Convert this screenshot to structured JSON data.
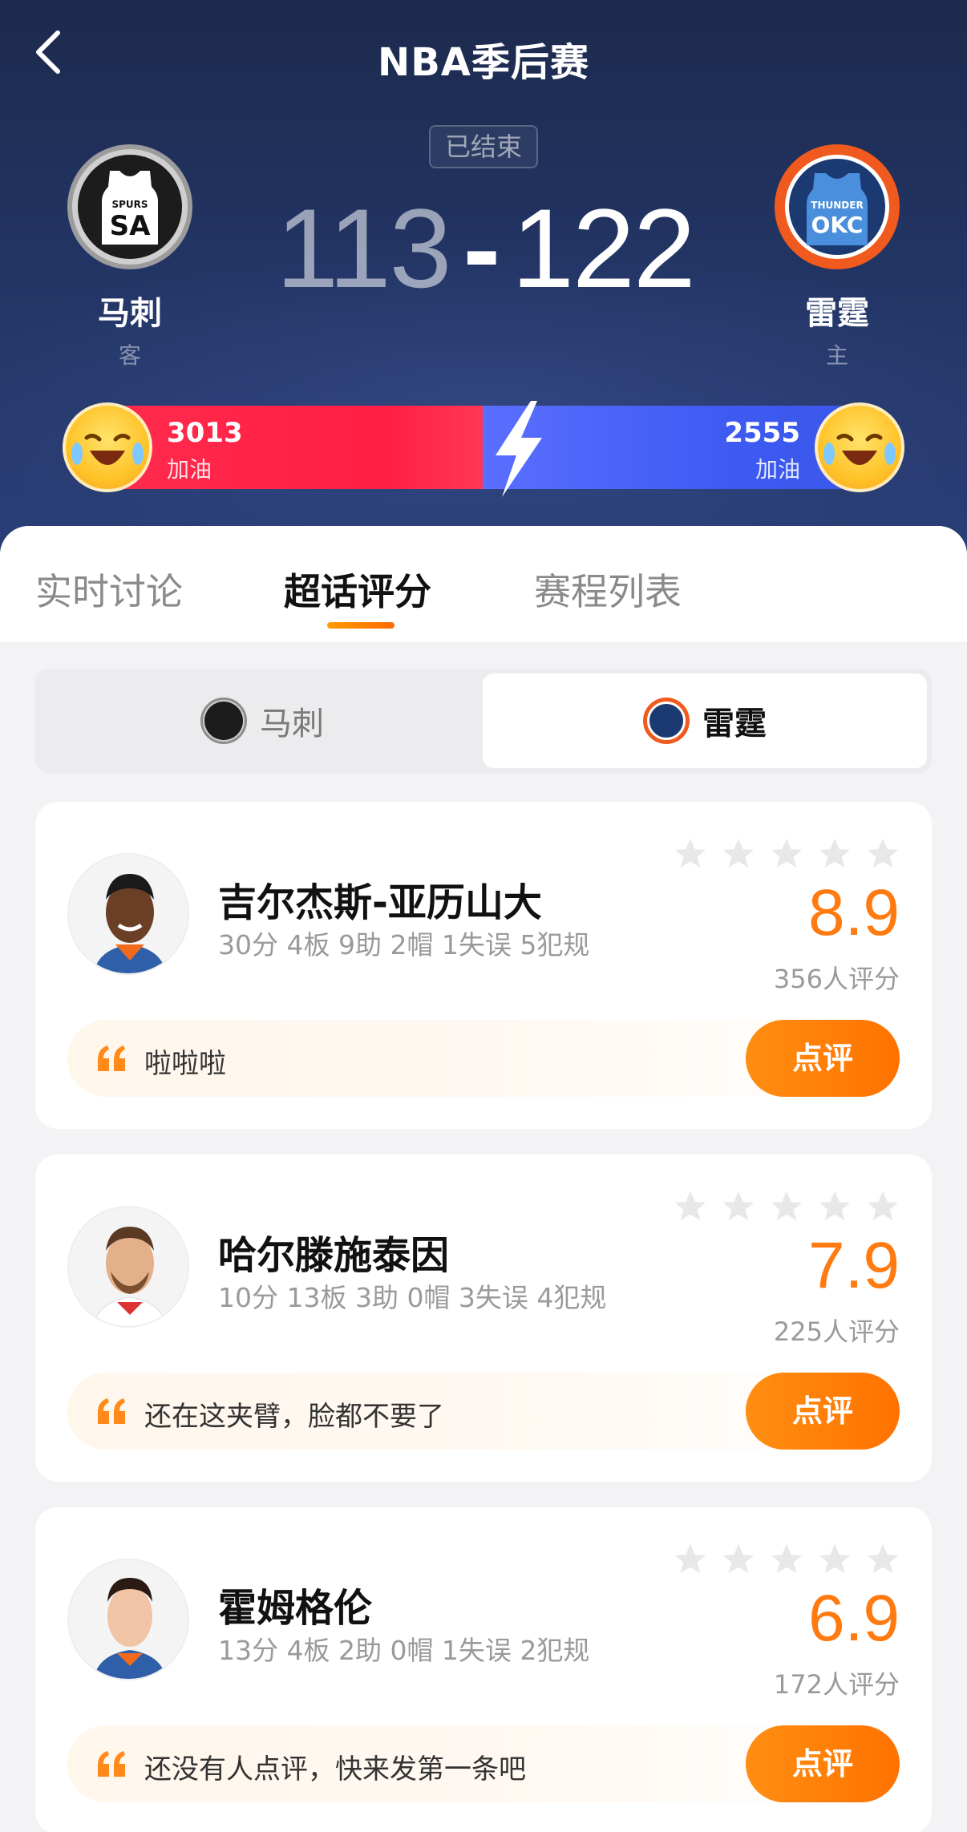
{
  "nav": {
    "title": "NBA季后赛",
    "back_icon": "chevron-left-icon"
  },
  "match": {
    "status": "已结束",
    "away": {
      "name": "马刺",
      "role": "客",
      "logo_text": "SA",
      "logo_sub": "SPURS",
      "score": "113"
    },
    "home": {
      "name": "雷霆",
      "role": "主",
      "logo_text": "OKC",
      "logo_sub": "THUNDER",
      "score": "122"
    },
    "separator": "-"
  },
  "cheer": {
    "away": {
      "count": "3013",
      "label": "加油"
    },
    "home": {
      "count": "2555",
      "label": "加油"
    },
    "colors": {
      "away": "#ff1e45",
      "home": "#3d5af2"
    }
  },
  "tabs": [
    {
      "label": "实时讨论",
      "active": false
    },
    {
      "label": "超话评分",
      "active": true
    },
    {
      "label": "赛程列表",
      "active": false
    }
  ],
  "team_switch": {
    "left": {
      "label": "马刺",
      "selected": false
    },
    "right": {
      "label": "雷霆",
      "selected": true
    }
  },
  "players": [
    {
      "name": "吉尔杰斯-亚历山大",
      "stats": "30分 4板 9助 2帽 1失误 5犯规",
      "rating": "8.9",
      "rating_count": "356人评分",
      "comment": "啦啦啦",
      "button": "点评"
    },
    {
      "name": "哈尔滕施泰因",
      "stats": "10分 13板 3助 0帽 3失误 4犯规",
      "rating": "7.9",
      "rating_count": "225人评分",
      "comment": "还在这夹臂，脸都不要了",
      "button": "点评"
    },
    {
      "name": "霍姆格伦",
      "stats": "13分 4板 2助 0帽 1失误 2犯规",
      "rating": "6.9",
      "rating_count": "172人评分",
      "comment": "还没有人点评，快来发第一条吧",
      "button": "点评"
    }
  ],
  "accent_color": "#ff7a10"
}
